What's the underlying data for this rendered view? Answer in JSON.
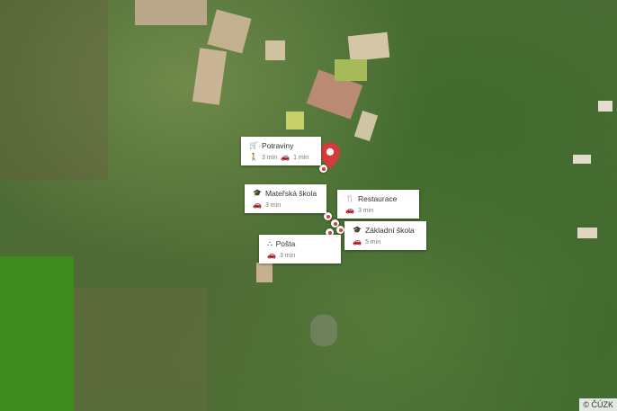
{
  "map": {
    "attribution": "© ČÚZK",
    "accent_color": "#d63a3a",
    "pois": [
      {
        "name": "Potraviny",
        "icon": "cart-icon",
        "walk_time": "3 min",
        "car_time": "1 min"
      },
      {
        "name": "Mateřská škola",
        "icon": "graduation-cap-icon",
        "car_time": "3 min"
      },
      {
        "name": "Restaurace",
        "icon": "fork-knife-icon",
        "car_time": "3 min"
      },
      {
        "name": "Základní škola",
        "icon": "graduation-cap-icon",
        "car_time": "5 min"
      },
      {
        "name": "Pošta",
        "icon": "post-office-icon",
        "car_time": "3 min"
      }
    ]
  }
}
